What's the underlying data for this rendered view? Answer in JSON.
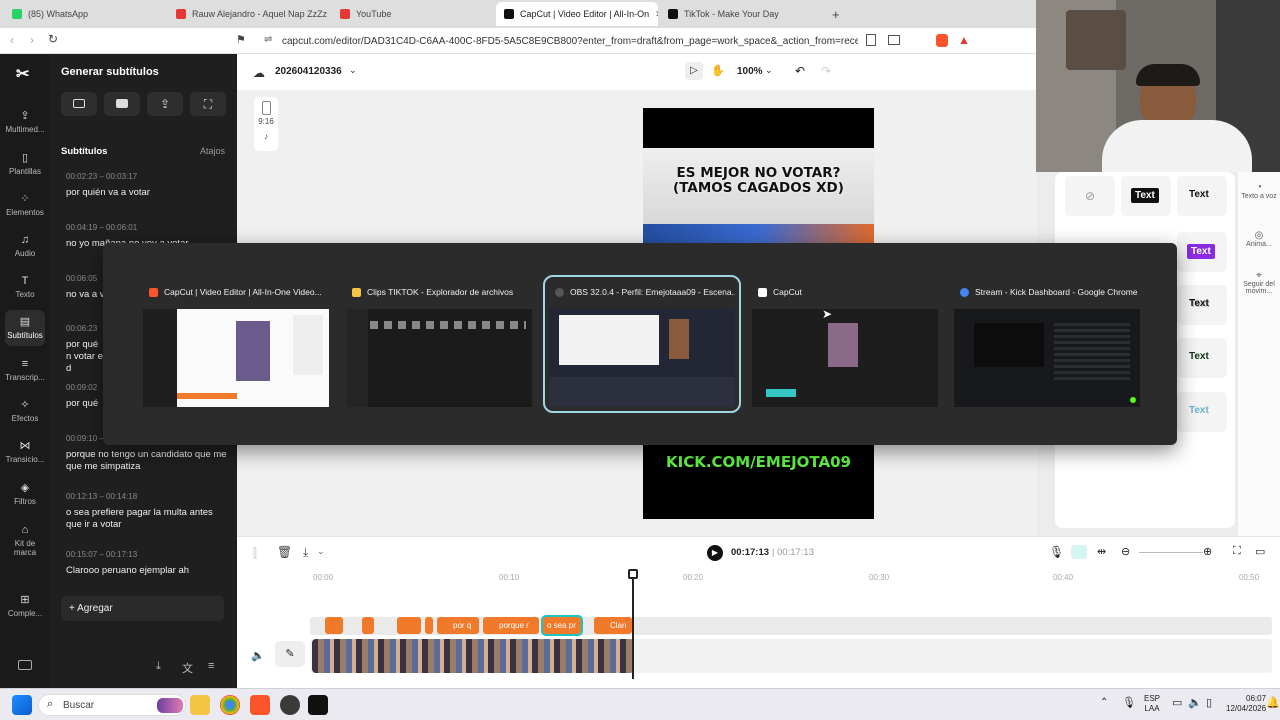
{
  "browser": {
    "tabs": [
      {
        "label": "(85) WhatsApp",
        "color": "#25d366"
      },
      {
        "label": "Rauw Alejandro - Aquel Nap ZzZz (Le",
        "color": "#e53935"
      },
      {
        "label": "YouTube",
        "color": "#e53935"
      },
      {
        "label": "CapCut | Video Editor | All-In-On",
        "color": "#111111",
        "active": true
      },
      {
        "label": "TikTok - Make Your Day",
        "color": "#111111"
      }
    ],
    "new_tab": "+",
    "url": "capcut.com/editor/DAD31C4D-C6AA-400C-8FD5-5A5C8E9CB800?enter_from=draft&from_page=work_space&_action_from=recent&wor..."
  },
  "rail": [
    {
      "label": "Multimed...",
      "icon": "cloud-upload-icon",
      "glyph": "⇪"
    },
    {
      "label": "Plantillas",
      "icon": "template-icon",
      "glyph": "▯"
    },
    {
      "label": "Elementos",
      "icon": "elements-icon",
      "glyph": "⁘"
    },
    {
      "label": "Audio",
      "icon": "music-icon",
      "glyph": "♫"
    },
    {
      "label": "Texto",
      "icon": "text-icon",
      "glyph": "T"
    },
    {
      "label": "Subtítulos",
      "icon": "subtitles-icon",
      "glyph": "▤",
      "active": true
    },
    {
      "label": "Transcrip...",
      "icon": "transcript-icon",
      "glyph": "≡"
    },
    {
      "label": "Efectos",
      "icon": "effects-icon",
      "glyph": "✧"
    },
    {
      "label": "Transicio...",
      "icon": "transition-icon",
      "glyph": "⋈"
    },
    {
      "label": "Filtros",
      "icon": "filter-icon",
      "glyph": "◈"
    },
    {
      "label": "Kit de marca",
      "icon": "brand-kit-icon",
      "glyph": "⌂"
    },
    {
      "label": "Comple...",
      "icon": "plugins-icon",
      "glyph": "⊞"
    }
  ],
  "panel": {
    "title": "Generar subtítulos",
    "section": "Subtítulos",
    "shortcut": "Atajos",
    "add": "Agregar",
    "subtitles": [
      {
        "time": "00:02:23 – 00:03:17",
        "text": "por quién va a votar"
      },
      {
        "time": "00:04:19 – 00:06:01",
        "text": "no yo mañana no voy a votar"
      },
      {
        "time": "00:06:05",
        "text": "no va a v"
      },
      {
        "time": "00:06:23",
        "text": "por qué n votar el d"
      },
      {
        "time": "00:09:02",
        "text": "por qué"
      },
      {
        "time": "00:09:10 – 00:12:07",
        "text": "porque no tengo un candidato que me que me simpatiza"
      },
      {
        "time": "00:12:13 – 00:14:18",
        "text": "o sea prefiere pagar la multa antes que ir a votar"
      },
      {
        "time": "00:15:07 – 00:17:13",
        "text": "Clarooo peruano ejemplar ah"
      }
    ]
  },
  "editor": {
    "project": "202604120336",
    "zoom": "100%",
    "ratio": "9:16",
    "preview_title": "ES MEJOR NO VOTAR? (TAMOS CAGADOS XD)",
    "preview_link": "KICK.COM/EMEJOTA09",
    "current_time": "00:17:13",
    "total_time": "00:17:13",
    "ruler": [
      "00:00",
      "00:10",
      "00:20",
      "00:30",
      "00:40",
      "00:50"
    ],
    "clips": [
      "",
      "",
      "",
      "por q",
      "porque r",
      "o sea pr",
      "Clan"
    ]
  },
  "right_panel": {
    "items": [
      "Text",
      "Text",
      "Text",
      "Text",
      "Text",
      "Text"
    ],
    "rail": [
      {
        "label": "Texto a voz"
      },
      {
        "label": "Anima..."
      },
      {
        "label": "Seguir del movim..."
      }
    ]
  },
  "switcher": [
    {
      "title": "CapCut | Video Editor | All-In-One Video...",
      "color": "#fb542b"
    },
    {
      "title": "Clips TIKTOK - Explorador de archivos",
      "color": "#f4c542"
    },
    {
      "title": "OBS 32.0.4 - Perfil: Emejotaaa09 - Escena...",
      "color": "#555555",
      "selected": true
    },
    {
      "title": "CapCut",
      "color": "#ffffff"
    },
    {
      "title": "Stream - Kick Dashboard - Google Chrome",
      "color": "#4285f4"
    }
  ],
  "taskbar": {
    "search": "Buscar",
    "lang1": "ESP",
    "lang2": "LAA",
    "time": "06:07",
    "date": "12/04/2026"
  }
}
